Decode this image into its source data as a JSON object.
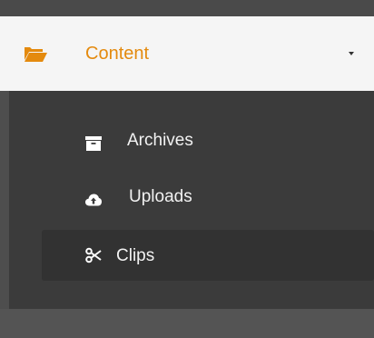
{
  "menu": {
    "header": {
      "label": "Content",
      "icon": "folder-open-icon",
      "accent_color": "#e48a0e",
      "expanded": true
    },
    "items": [
      {
        "label": "Archives",
        "icon": "archive-icon",
        "active": false
      },
      {
        "label": "Uploads",
        "icon": "cloud-upload-icon",
        "active": false
      },
      {
        "label": "Clips",
        "icon": "scissors-icon",
        "active": true
      }
    ]
  }
}
